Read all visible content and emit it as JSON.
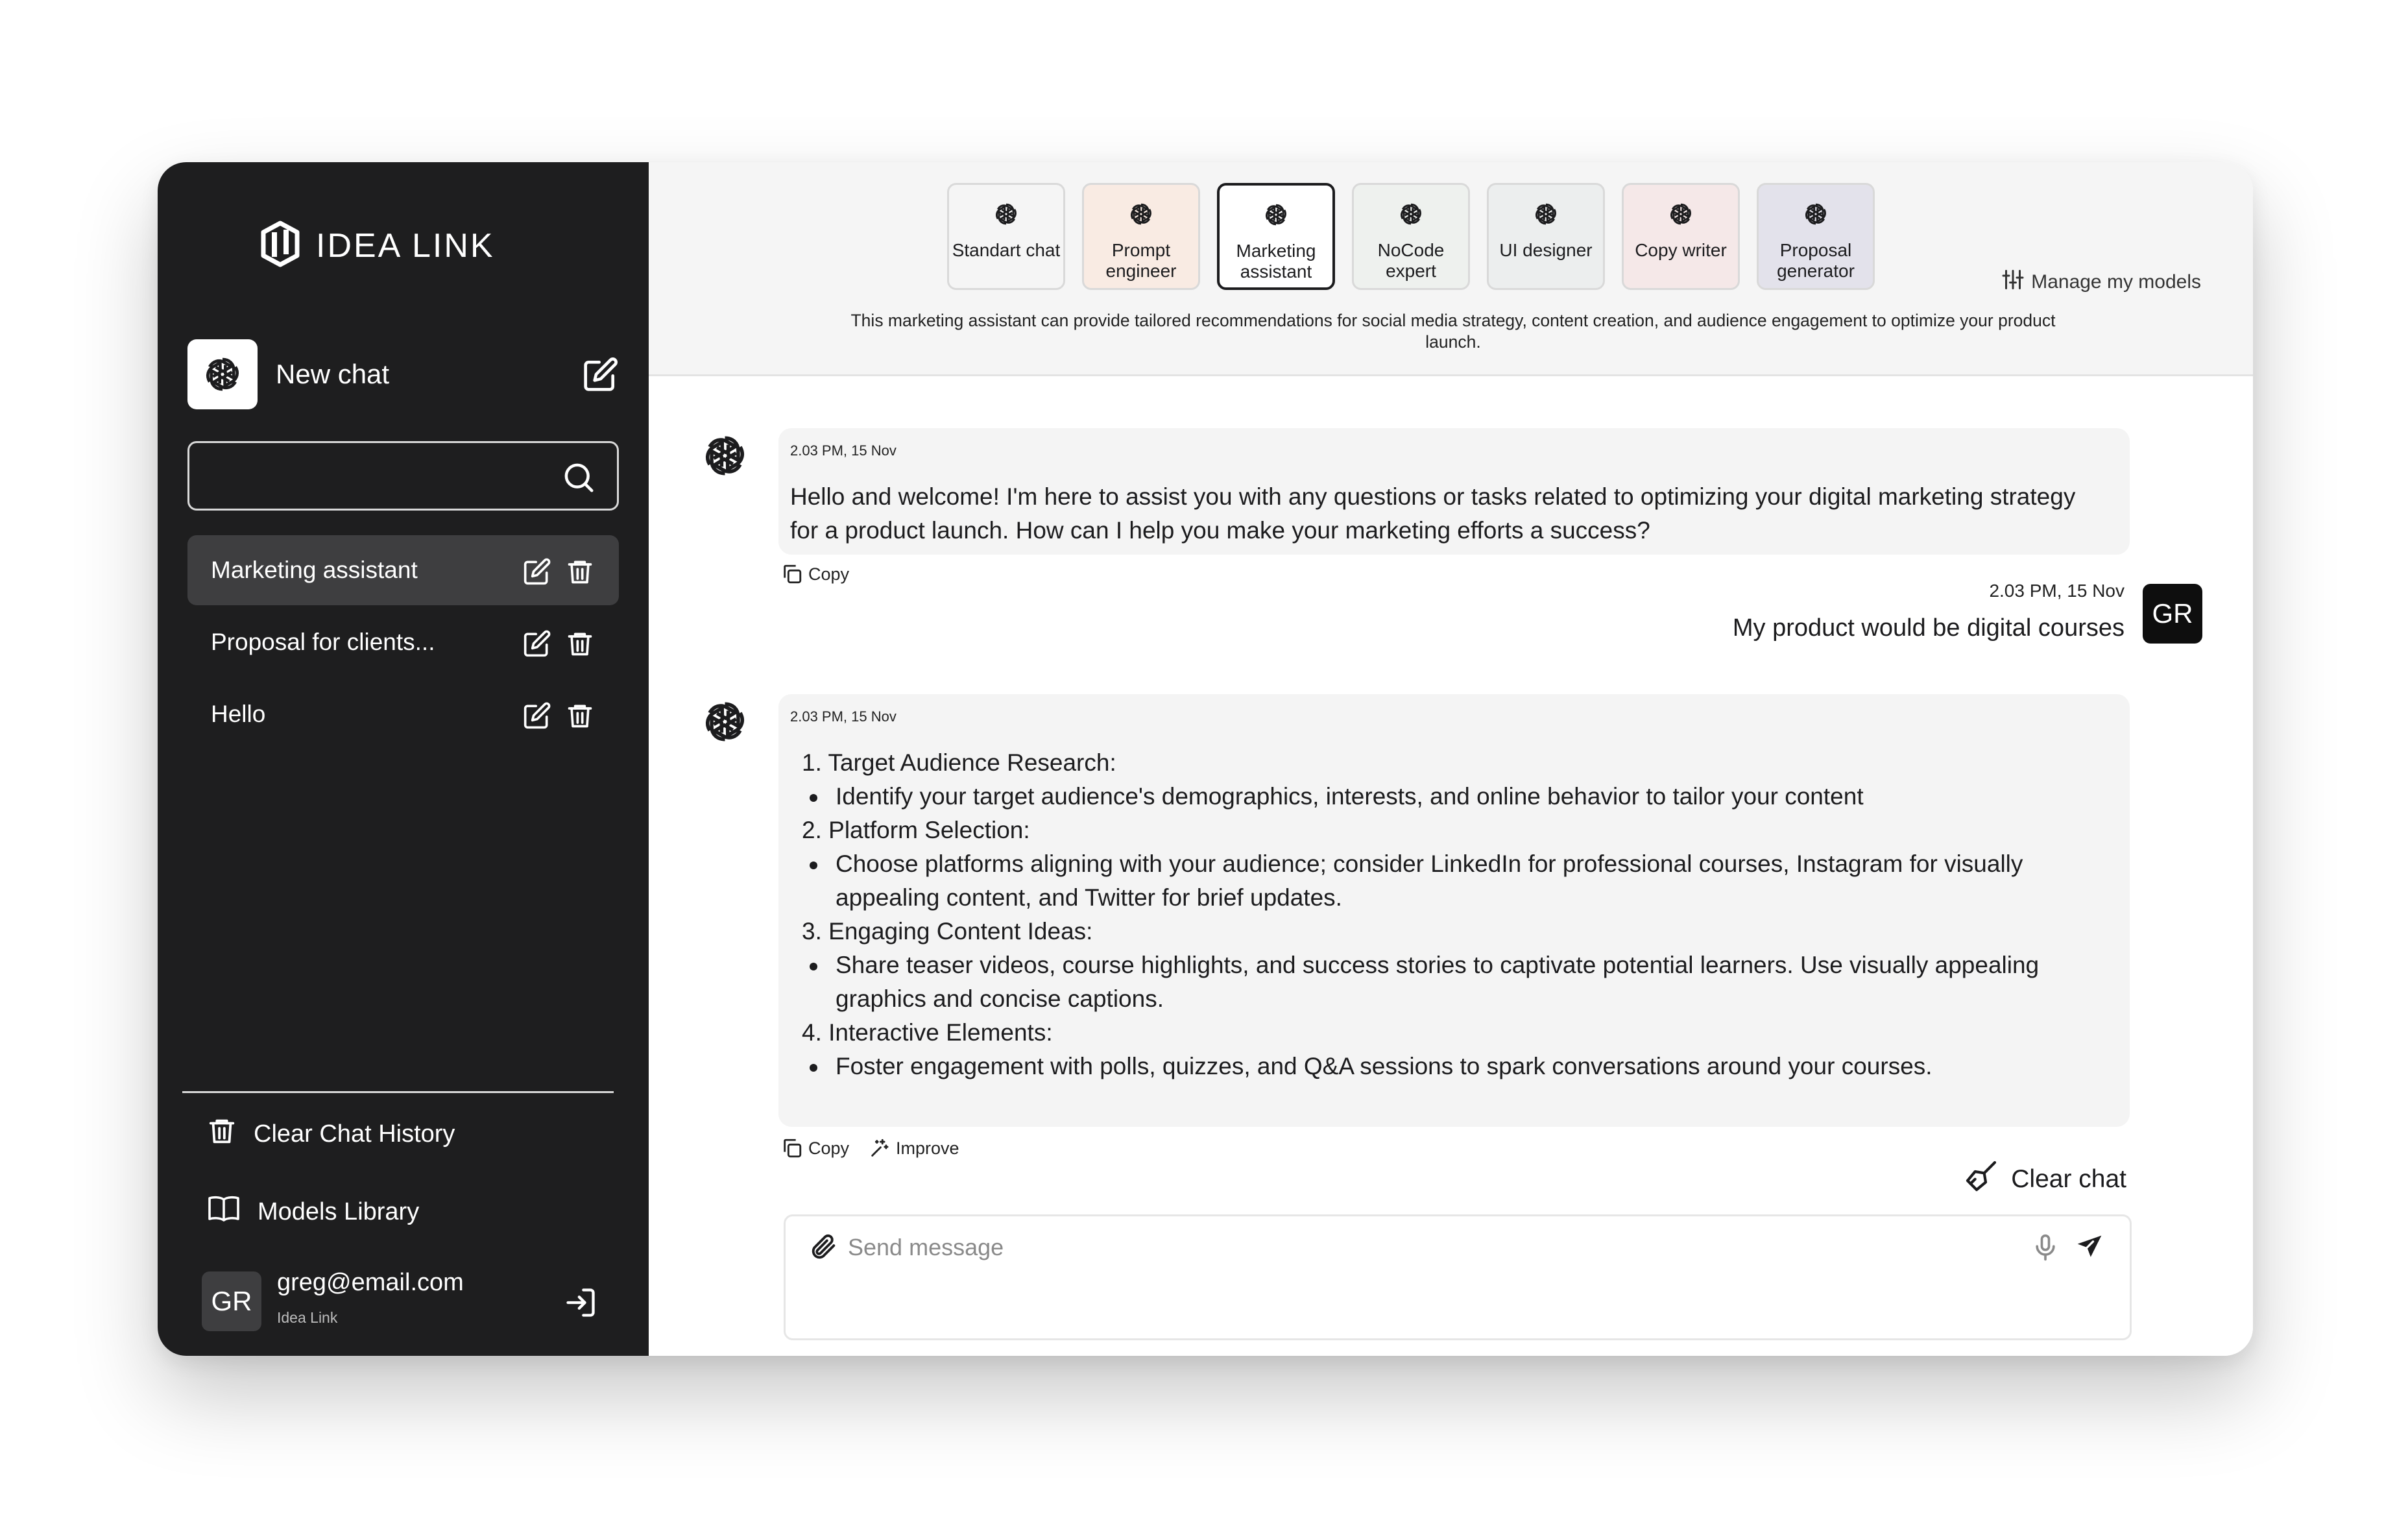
{
  "colors": {
    "sidebar_bg": "#1e1e1f",
    "active_item_bg": "#3e3e40",
    "accent": "#1c1c1e"
  },
  "brand": {
    "name": "IDEA LINK",
    "icon": "idea-link-logo"
  },
  "sidebar": {
    "new_chat_label": "New chat",
    "search_placeholder": "",
    "chats": [
      {
        "label": "Marketing assistant",
        "active": true
      },
      {
        "label": "Proposal for clients...",
        "active": false
      },
      {
        "label": "Hello",
        "active": false
      }
    ],
    "clear_history_label": "Clear Chat History",
    "models_library_label": "Models Library",
    "user": {
      "initials": "GR",
      "email": "greg@email.com",
      "workspace": "Idea Link"
    }
  },
  "models": [
    {
      "label": "Standart chat",
      "bg": "#f5f5f5",
      "active": false
    },
    {
      "label": "Prompt engineer",
      "bg": "#f9ebe3",
      "active": false
    },
    {
      "label": "Marketing assistant",
      "bg": "#ffffff",
      "active": true
    },
    {
      "label": "NoCode expert",
      "bg": "#eef1ee",
      "active": false
    },
    {
      "label": "UI designer",
      "bg": "#eceeee",
      "active": false
    },
    {
      "label": "Copy writer",
      "bg": "#f5e8e8",
      "active": false
    },
    {
      "label": "Proposal generator",
      "bg": "#e3e2eb",
      "active": false
    }
  ],
  "manage_models_label": "Manage my models",
  "model_description": "This marketing assistant can provide tailored recommendations for social media strategy, content creation, and audience engagement to optimize your product launch.",
  "messages": {
    "first": {
      "timestamp": "2.03 PM, 15 Nov",
      "text": "Hello and welcome!  I'm here to assist you with any questions or tasks related to optimizing your digital marketing strategy for a product launch. How can I help you make your marketing efforts a success?",
      "copy_label": "Copy"
    },
    "user": {
      "timestamp": "2.03 PM, 15 Nov",
      "text": "My product would be digital courses",
      "initials": "GR"
    },
    "second": {
      "timestamp": "2.03 PM, 15 Nov",
      "lines": [
        {
          "kind": "step",
          "text": "1. Target Audience Research:"
        },
        {
          "kind": "bullet",
          "text": "Identify your target audience's demographics, interests, and online behavior to tailor your content"
        },
        {
          "kind": "step",
          "text": "2. Platform Selection:"
        },
        {
          "kind": "bullet",
          "text": "Choose platforms aligning with your audience; consider LinkedIn for professional courses, Instagram for visually appealing content, and Twitter for brief updates."
        },
        {
          "kind": "step",
          "text": "3. Engaging Content Ideas:"
        },
        {
          "kind": "bullet",
          "text": "Share teaser videos, course highlights, and success stories to captivate potential learners. Use visually appealing graphics and concise captions."
        },
        {
          "kind": "step",
          "text": "4. Interactive Elements:"
        },
        {
          "kind": "bullet",
          "text": "Foster engagement with polls, quizzes, and Q&A sessions to spark conversations around your courses."
        }
      ],
      "copy_label": "Copy",
      "improve_label": "Improve"
    }
  },
  "clear_chat_label": "Clear chat",
  "composer": {
    "placeholder": "Send message"
  }
}
